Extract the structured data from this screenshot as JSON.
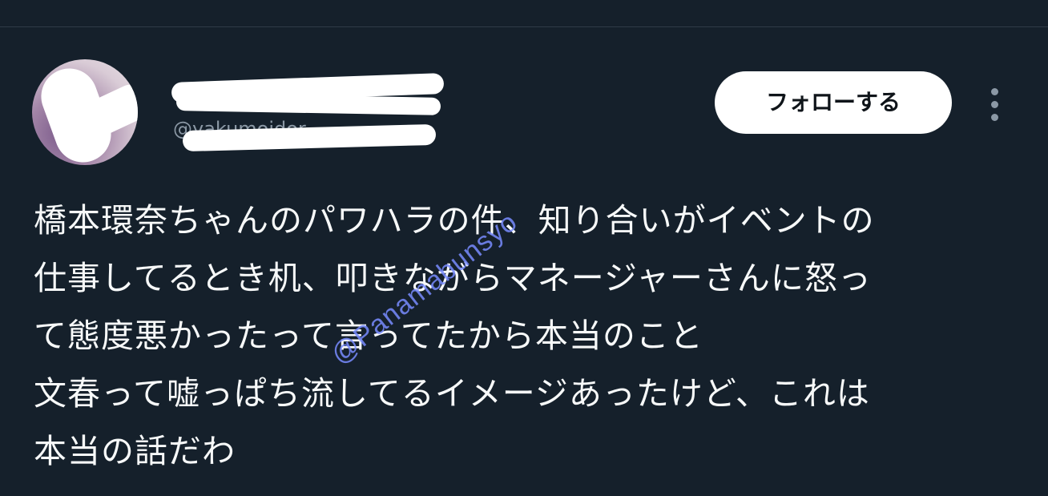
{
  "post": {
    "display_name": "",
    "handle": "@yakumoidor...",
    "follow_label": "フォローする",
    "more_icon": "more-vertical-icon",
    "text_lines": [
      "橋本環奈ちゃんのパワハラの件、知り合いがイベントの",
      "仕事してるとき机、叩きながらマネージャーさんに怒っ",
      "て態度悪かったって言ってたから本当のこと",
      "文春って嘘っぱち流してるイメージあったけど、これは",
      "本当の話だわ"
    ]
  },
  "watermark": {
    "text": "@Panamabunsyo"
  },
  "colors": {
    "background": "#15202b",
    "text": "#f7f9f9",
    "secondary_text": "#8b98a5",
    "button_bg": "#ffffff",
    "watermark": "#7888ff"
  }
}
